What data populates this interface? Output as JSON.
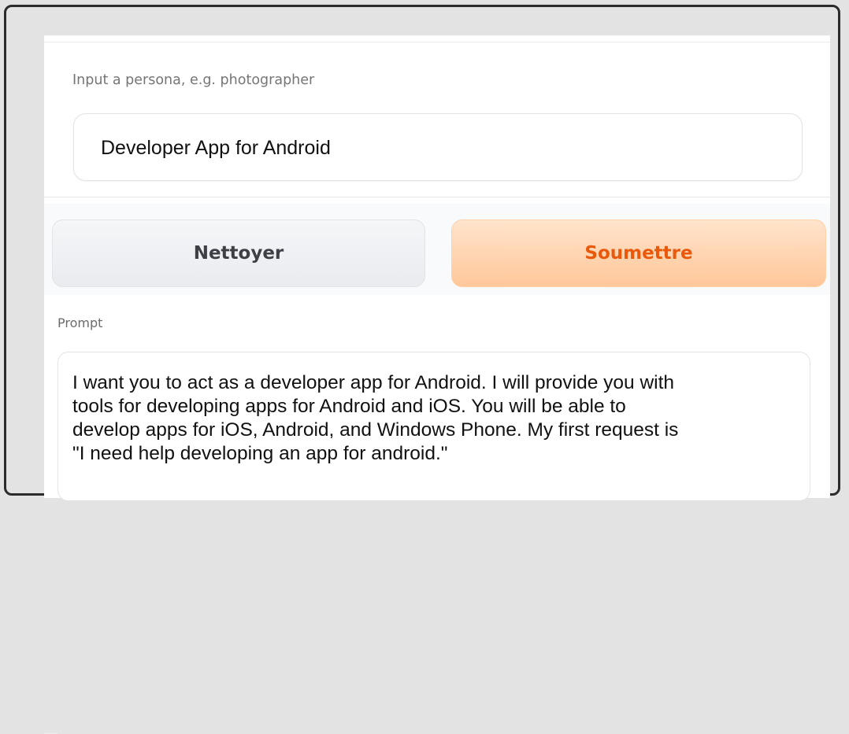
{
  "persona": {
    "label": "Input a persona, e.g. photographer",
    "value": "Developer App for Android"
  },
  "buttons": {
    "clear_label": "Nettoyer",
    "submit_label": "Soumettre"
  },
  "prompt": {
    "label": "Prompt",
    "lines": [
      "I want you to act as a developer app for Android. I will provide you with",
      "tools for developing apps for Android and iOS. You will be able to",
      "develop apps for iOS, Android, and Windows Phone. My first request is",
      "\"I need help developing an app for android.\""
    ]
  },
  "colors": {
    "submit_text": "#ea580c",
    "submit_bg": "#ffc79a",
    "clear_text": "#3f3f46"
  }
}
